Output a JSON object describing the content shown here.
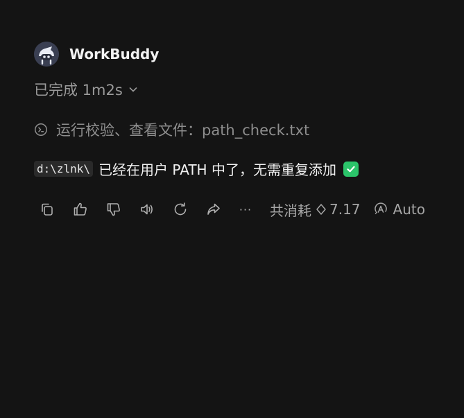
{
  "header": {
    "app_name": "WorkBuddy",
    "avatar_icon": "robot-avatar-icon"
  },
  "status": {
    "label": "已完成 1m2s",
    "expand_icon": "chevron-down-icon"
  },
  "step": {
    "icon": "terminal-icon",
    "label": "运行校验、查看文件：path_check.txt"
  },
  "message": {
    "code": "d:\\zlnk\\",
    "text": "已经在用户 PATH 中了，无需重复添加",
    "emoji_icon": "check-mark-button-icon"
  },
  "actions": {
    "items": [
      "copy-icon",
      "thumbs-up-icon",
      "thumbs-down-icon",
      "speaker-icon",
      "refresh-icon",
      "share-icon",
      "more-icon"
    ],
    "more_label": "···",
    "usage_label": "共消耗",
    "usage_value": "7.17",
    "model_label": "Auto"
  },
  "colors": {
    "background": "#141414",
    "accent_check": "#2bc46a",
    "avatar_bg": "#3a3f52"
  }
}
